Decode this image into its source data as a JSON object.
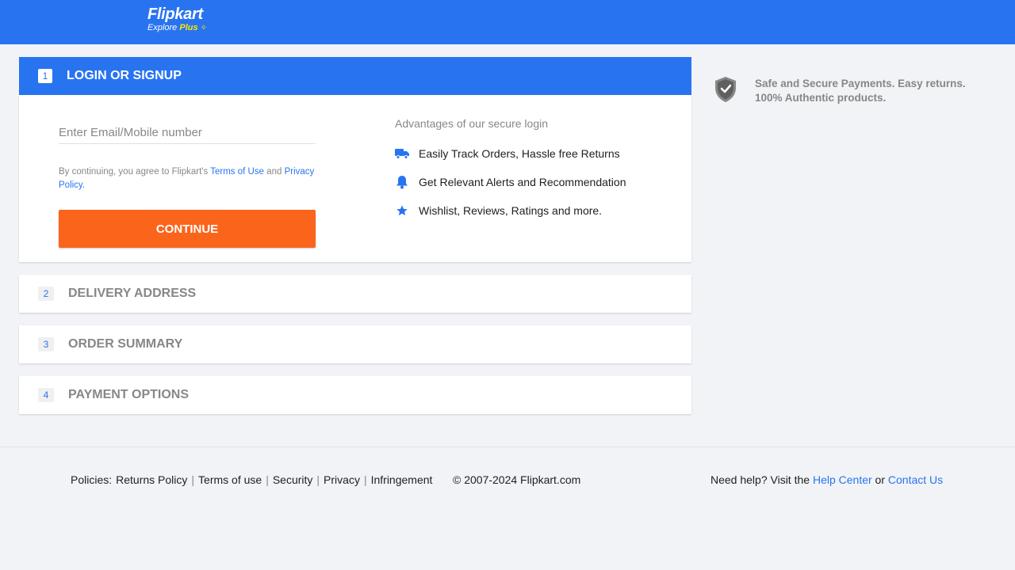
{
  "header": {
    "logo_main": "Flipkart",
    "logo_sub_prefix": "Explore",
    "logo_sub_plus": "Plus",
    "brand_color": "#2874f0"
  },
  "login_step": {
    "number": "1",
    "title": "LOGIN OR SIGNUP",
    "email_placeholder": "Enter Email/Mobile number",
    "email_value": "",
    "terms_prefix": "By continuing, you agree to Flipkart's",
    "terms_link": "Terms of Use",
    "terms_and": "and",
    "privacy_link": "Privacy Policy.",
    "continue_label": "CONTINUE",
    "continue_color": "#fb641b"
  },
  "advantages": {
    "title": "Advantages of our secure login",
    "items": [
      {
        "icon": "truck-icon",
        "label": "Easily Track Orders, Hassle free Returns"
      },
      {
        "icon": "bell-icon",
        "label": "Get Relevant Alerts and Recommendation"
      },
      {
        "icon": "star-icon",
        "label": "Wishlist, Reviews, Ratings and more."
      }
    ]
  },
  "steps": [
    {
      "number": "2",
      "title": "DELIVERY ADDRESS"
    },
    {
      "number": "3",
      "title": "ORDER SUMMARY"
    },
    {
      "number": "4",
      "title": "PAYMENT OPTIONS"
    }
  ],
  "secure": {
    "icon": "shield-check-icon",
    "line1": "Safe and Secure Payments. Easy returns.",
    "line2": "100% Authentic products."
  },
  "footer": {
    "policies_label": "Policies:",
    "links": [
      "Returns Policy",
      "Terms of use",
      "Security",
      "Privacy",
      "Infringement"
    ],
    "copyright": "© 2007-2024 Flipkart.com",
    "help_prefix": "Need help? Visit the",
    "help_center": "Help Center",
    "help_or": "or",
    "contact_us": "Contact Us"
  }
}
